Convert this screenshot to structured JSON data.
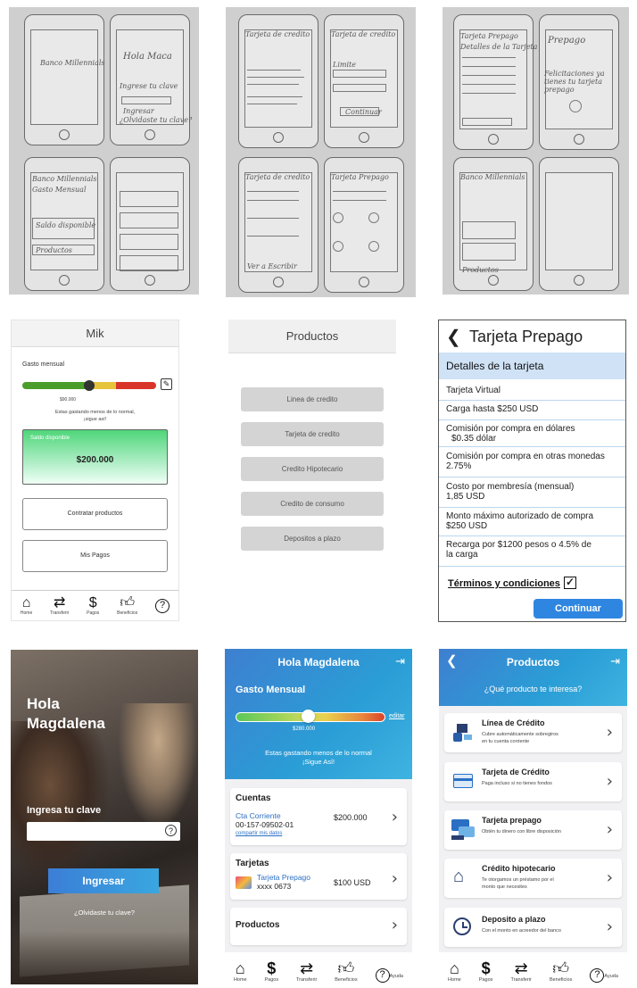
{
  "sketches": {
    "p1": [
      "Banco Millennials",
      "Hola Maca",
      "Ingrese tu clave",
      "Ingresar",
      "¿Olvidaste tu clave?",
      "Banco Millennials",
      "Gasto Mensual",
      "Saldo disponible",
      "Productos"
    ],
    "p2": [
      "Tarjeta de credito",
      "Tarjeta de credito",
      "Limite",
      "Continuar",
      "Tarjeta de credito",
      "Tarjeta Prepago",
      "Ver a Escribir"
    ],
    "p3": [
      "Tarjeta Prepago",
      "Detalles de la Tarjeta",
      "Prepago",
      "Felicitaciones ya tienes tu tarjeta prepago",
      "Banco Millennials",
      "Productos"
    ]
  },
  "wire_home": {
    "title": "Mik",
    "gasto_label": "Gasto mensual",
    "gauge_value": "$90.000",
    "gauge_position": 0.5,
    "note_line1": "Estas gastando menos de lo normal,",
    "note_line2": "¡sigue así!",
    "saldo_label": "Saldo disponible",
    "saldo_amount": "$200.000",
    "btn_contratar": "Contratar productos",
    "btn_pagos": "Mis Pagos",
    "tabs": [
      "Home",
      "Transferir",
      "Pagos",
      "Beneficios",
      ""
    ]
  },
  "wire_products": {
    "title": "Productos",
    "items": [
      "Linea de credito",
      "Tarjeta de credito",
      "Credito Hipotecario",
      "Credito de consumo",
      "Depositos a plazo"
    ]
  },
  "tarjeta_prepago": {
    "back": "<",
    "title": "Tarjeta Prepago",
    "section": "Detalles de la tarjeta",
    "rows": [
      "Tarjeta Virtual",
      "Carga hasta $250 USD",
      "Comisión por compra en dólares",
      "$0.35 dólar",
      "Comisión por compra en otras monedas",
      "2.75%",
      "Costo por membresía (mensual)",
      "1,85 USD",
      "Monto máximo autorizado de compra",
      "$250 USD",
      "Recarga por $1200 pesos o 4.5% de",
      "la carga"
    ],
    "terms": "Términos y condiciones",
    "terms_checked": true,
    "continue": "Continuar",
    "accent": "#2f86e0"
  },
  "login": {
    "greeting_line1": "Hola",
    "greeting_line2": "Magdalena",
    "clave_label": "Ingresa tu clave",
    "clave_value": "",
    "help_icon": "?",
    "ingresar": "Ingresar",
    "forgot": "¿Olvidaste tu clave?"
  },
  "home_final": {
    "title": "Hola Magdalena",
    "gasto_label": "Gasto Mensual",
    "gauge_value": "$280.000",
    "gauge_position": 0.48,
    "edit_link": "editar",
    "note_line1": "Estas gastando menos de lo normal",
    "note_line2": "¡Sigue Así!",
    "cuentas_title": "Cuentas",
    "cuenta_name": "Cta Corriente",
    "cuenta_number": "00-157-09502-01",
    "cuenta_share": "compartir mis datos",
    "cuenta_amount": "$200.000",
    "tarjetas_title": "Tarjetas",
    "tarjeta_name": "Tarjeta Prepago",
    "tarjeta_number": "xxxx 0673",
    "tarjeta_amount": "$100 USD",
    "productos_title": "Productos",
    "tabs": [
      "Home",
      "Pagos",
      "Transferir",
      "Beneficios",
      "Ayuda"
    ]
  },
  "products_final": {
    "title": "Productos",
    "question": "¿Qué producto te interesa?",
    "items": [
      {
        "title": "Línea de Crédito",
        "desc1": "Cubre automáticamente sobregiros",
        "desc2": "en tu cuenta corriente"
      },
      {
        "title": "Tarjeta de Crédito",
        "desc1": "Paga incluso si no tienes fondos",
        "desc2": ""
      },
      {
        "title": "Tarjeta prepago",
        "desc1": "Obtén tu dinero con libre disposición",
        "desc2": ""
      },
      {
        "title": "Crédito hipotecario",
        "desc1": "Te otorgamos un préstamo por el",
        "desc2": "monto que necesites"
      },
      {
        "title": "Deposito a plazo",
        "desc1": "Con el monto en acreedor del banco",
        "desc2": ""
      }
    ],
    "tabs": [
      "Home",
      "Pagos",
      "Transferir",
      "Beneficios",
      "Ayuda"
    ]
  }
}
